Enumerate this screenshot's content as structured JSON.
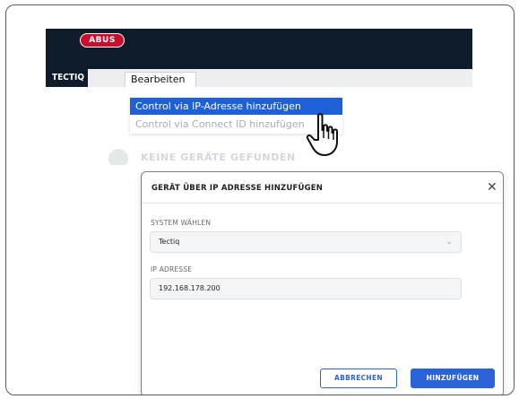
{
  "header": {
    "logo_text": "ABUS"
  },
  "menubar": {
    "tectiq_label": "TECTIQ",
    "edit_label": "Bearbeiten"
  },
  "dropdown": {
    "items": [
      {
        "label": "Control via IP-Adresse hinzufügen",
        "state": "highlighted"
      },
      {
        "label": "Control via Connect ID hinzufügen",
        "state": "disabled"
      }
    ]
  },
  "empty_state": {
    "text": "KEINE GERÄTE GEFUNDEN",
    "icon": "status-icon"
  },
  "cursor": {
    "icon": "hand-pointer-icon"
  },
  "dialog": {
    "title": "GERÄT ÜBER IP ADRESSE HINZUFÜGEN",
    "close_icon": "close-icon",
    "system": {
      "label": "SYSTEM WÄHLEN",
      "value": "Tectiq",
      "chevron": "chevron-down-icon"
    },
    "ip": {
      "label": "IP ADRESSE",
      "value": "192.168.178.200"
    },
    "cancel_label": "ABBRECHEN",
    "add_label": "HINZUFÜGEN"
  },
  "colors": {
    "header_bg": "#0e1b2b",
    "accent": "#2a62d8",
    "brand_red": "#c8102e"
  }
}
